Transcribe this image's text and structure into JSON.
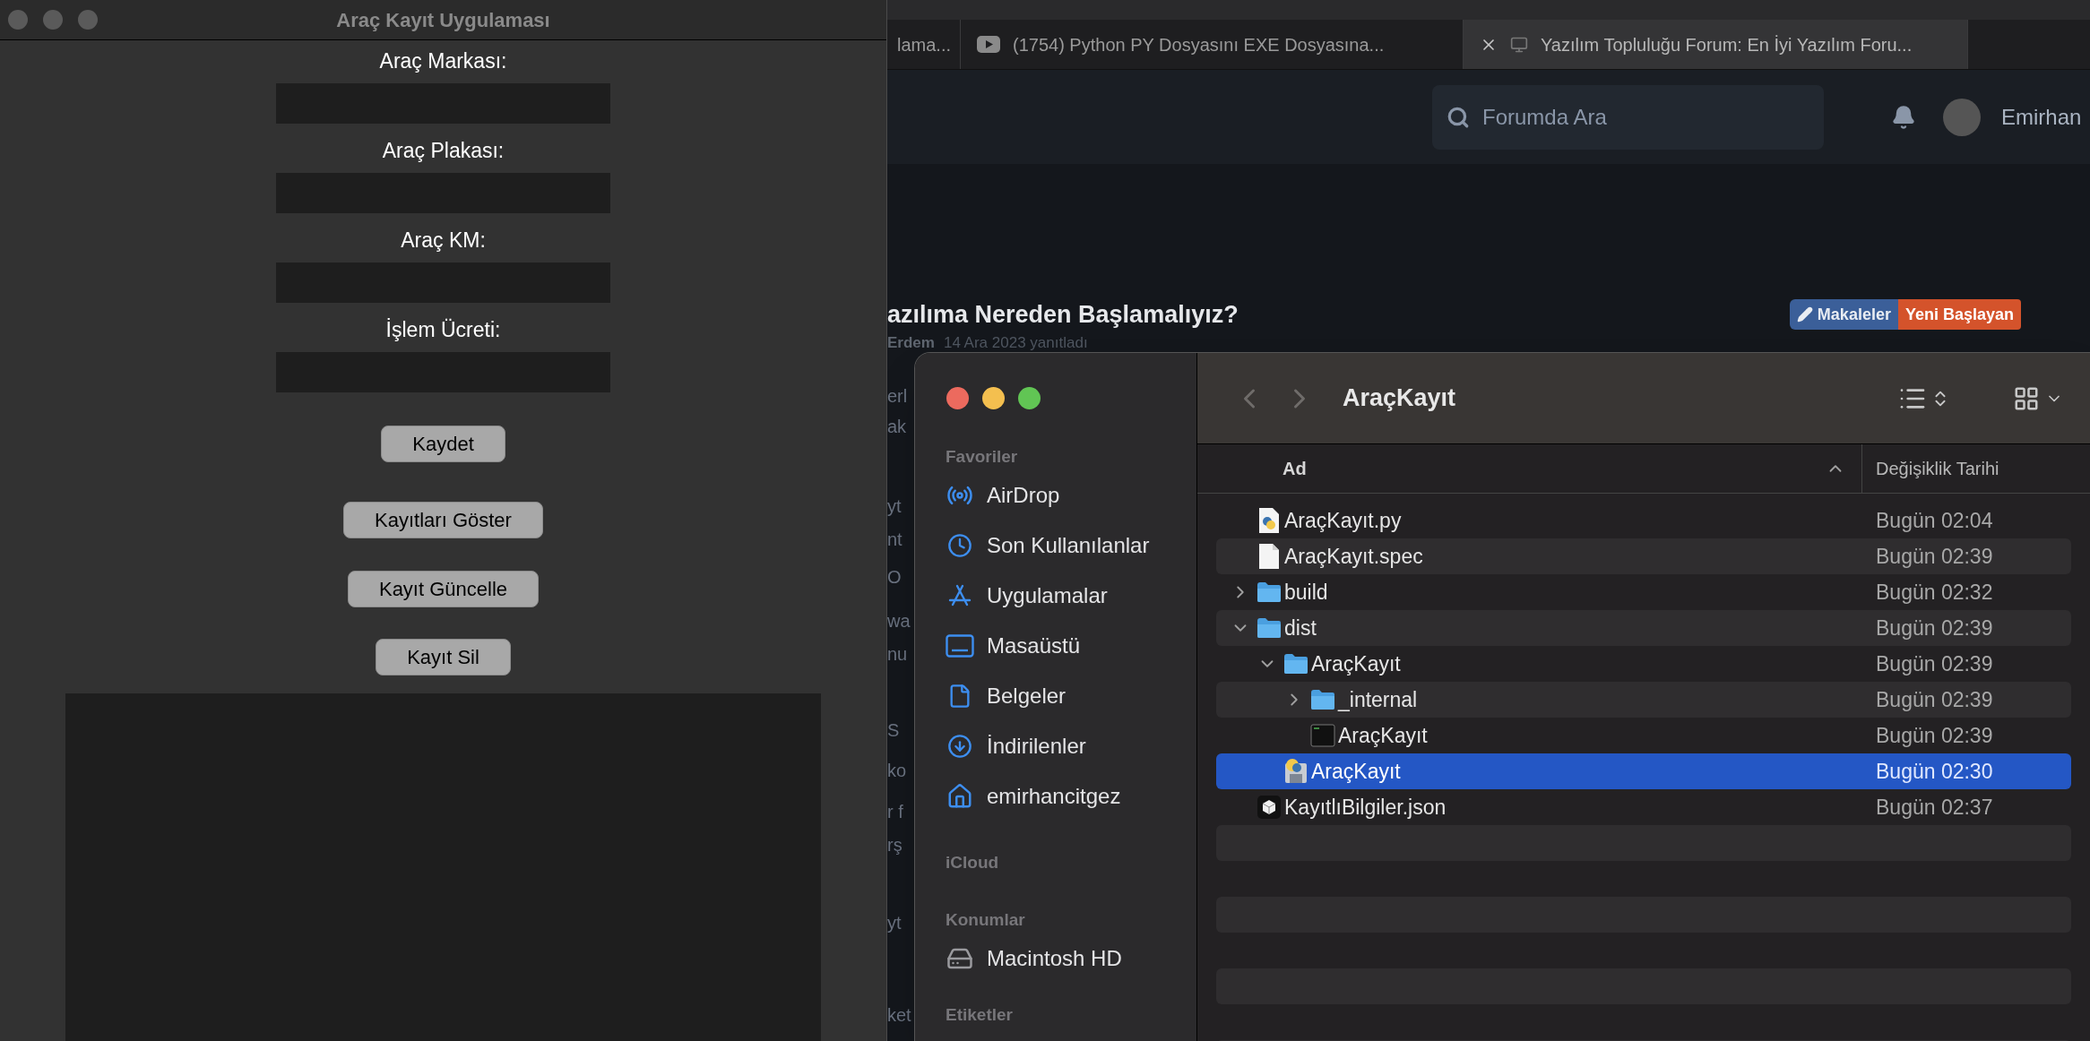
{
  "app_window": {
    "title": "Araç Kayıt Uygulaması",
    "fields": [
      {
        "label": "Araç Markası:"
      },
      {
        "label": "Araç Plakası:"
      },
      {
        "label": "Araç KM:"
      },
      {
        "label": "İşlem Ücreti:"
      }
    ],
    "buttons": [
      "Kaydet",
      "Kayıtları Göster",
      "Kayıt Güncelle",
      "Kayıt Sil"
    ]
  },
  "browser": {
    "tabs": [
      {
        "title": "lama...",
        "selected": false
      },
      {
        "title": "(1754) Python PY Dosyasını EXE Dosyasına...",
        "selected": false
      },
      {
        "title": "Yazılım Topluluğu Forum: En İyi Yazılım Foru...",
        "selected": true
      }
    ],
    "search": {
      "placeholder": "Forumda Ara"
    },
    "user": {
      "name": "Emirhan"
    },
    "post": {
      "title": "azılıma Nereden Başlamalıyız?",
      "author": "Erdem",
      "meta": "14 Ara 2023 yanıtladı",
      "tags": [
        {
          "label": "Makaleler",
          "color": "#3b5f99"
        },
        {
          "label": "Yeni Başlayan",
          "color": "#d4532b"
        }
      ]
    },
    "fragments": [
      "erl",
      "ak",
      "yt",
      "nt",
      "O",
      "wa",
      "nu",
      "S",
      "ko",
      "r f",
      "rş",
      "yt",
      "ket"
    ]
  },
  "finder": {
    "title": "AraçKayıt",
    "sidebar": [
      {
        "heading": "Favoriler",
        "items": [
          {
            "label": "AirDrop"
          },
          {
            "label": "Son Kullanılanlar"
          },
          {
            "label": "Uygulamalar"
          },
          {
            "label": "Masaüstü"
          },
          {
            "label": "Belgeler"
          },
          {
            "label": "İndirilenler"
          },
          {
            "label": "emirhancitgez"
          }
        ]
      },
      {
        "heading": "iCloud"
      },
      {
        "heading": "Konumlar",
        "items": [
          {
            "label": "Macintosh HD"
          }
        ]
      },
      {
        "heading": "Etiketler"
      }
    ],
    "columns": [
      "Ad",
      "Değişiklik Tarihi"
    ],
    "rows": [
      {
        "name": "AraçKayıt.py",
        "date": "Bugün 02:04",
        "kind": "python",
        "selected": false
      },
      {
        "name": "AraçKayıt.spec",
        "date": "Bugün 02:39",
        "kind": "document",
        "selected": false
      },
      {
        "name": "build",
        "date": "Bugün 02:32",
        "kind": "folder",
        "expanded": false,
        "selected": false
      },
      {
        "name": "dist",
        "date": "Bugün 02:39",
        "kind": "folder",
        "expanded": true,
        "selected": false,
        "children": [
          {
            "name": "AraçKayıt",
            "date": "Bugün 02:39",
            "kind": "folder",
            "expanded": true,
            "selected": false,
            "children": [
              {
                "name": "_internal",
                "date": "Bugün 02:39",
                "kind": "folder",
                "expanded": false,
                "selected": false
              },
              {
                "name": "AraçKayıt",
                "date": "Bugün 02:39",
                "kind": "executable",
                "selected": false
              }
            ]
          },
          {
            "name": "AraçKayıt",
            "date": "Bugün 02:30",
            "kind": "app",
            "selected": true
          }
        ]
      },
      {
        "name": "KayıtlıBilgiler.json",
        "date": "Bugün 02:37",
        "kind": "json",
        "selected": false
      }
    ]
  }
}
